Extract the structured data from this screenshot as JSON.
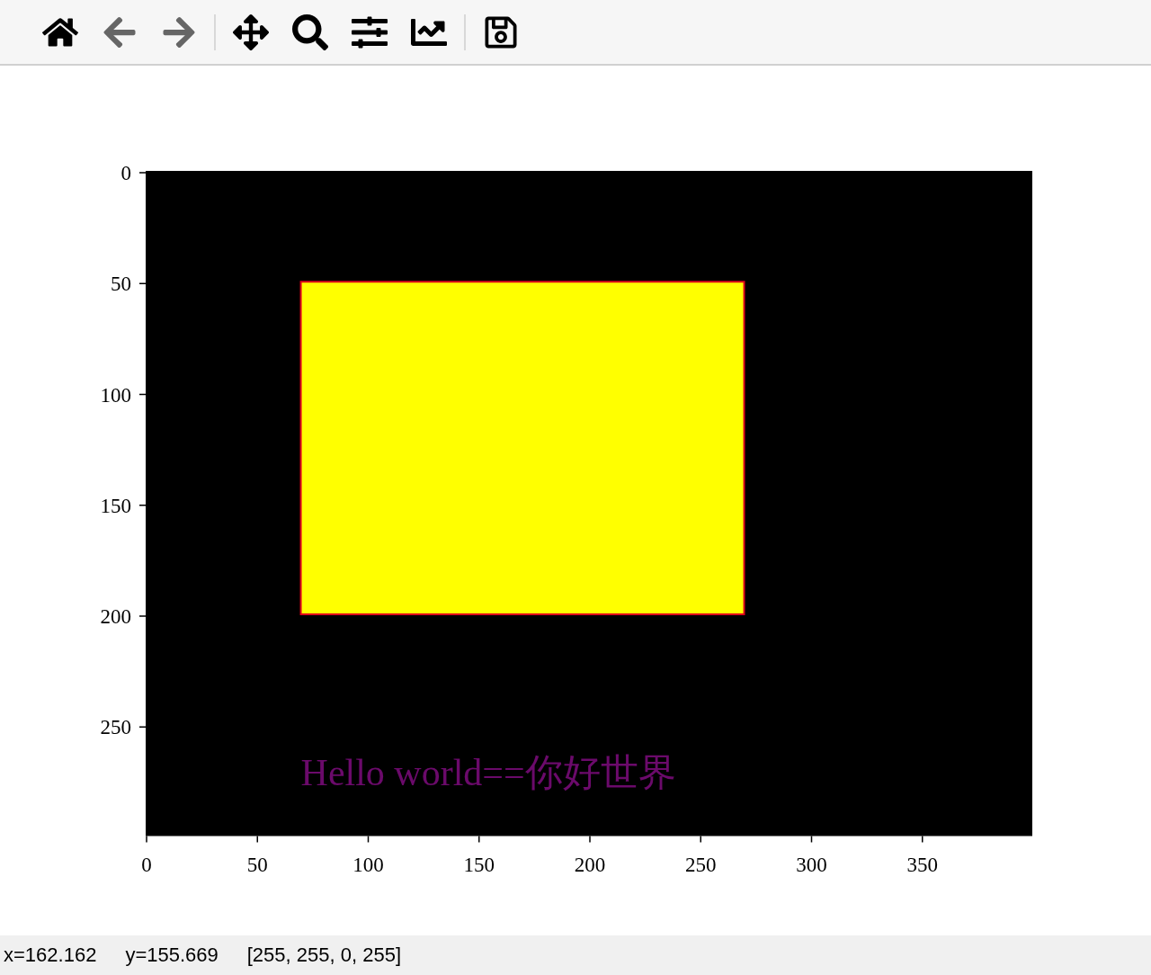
{
  "toolbar": {
    "tools": [
      {
        "kind": "home",
        "disabled": false
      },
      {
        "kind": "back",
        "disabled": true
      },
      {
        "kind": "forward",
        "disabled": true,
        "separator_after": true
      },
      {
        "kind": "pan",
        "disabled": false
      },
      {
        "kind": "zoom",
        "disabled": false
      },
      {
        "kind": "configure",
        "disabled": false
      },
      {
        "kind": "edit-axes",
        "disabled": false,
        "separator_after": true
      },
      {
        "kind": "save",
        "disabled": false
      }
    ]
  },
  "figure": {
    "image_text": "Hello world==你好世界",
    "x_ticks": [
      "0",
      "50",
      "100",
      "150",
      "200",
      "250",
      "300",
      "350"
    ],
    "y_ticks": [
      "0",
      "50",
      "100",
      "150",
      "200",
      "250"
    ]
  },
  "status_bar": {
    "x": "x=162.162",
    "y": "y=155.669",
    "value": "[255, 255, 0, 255]"
  }
}
